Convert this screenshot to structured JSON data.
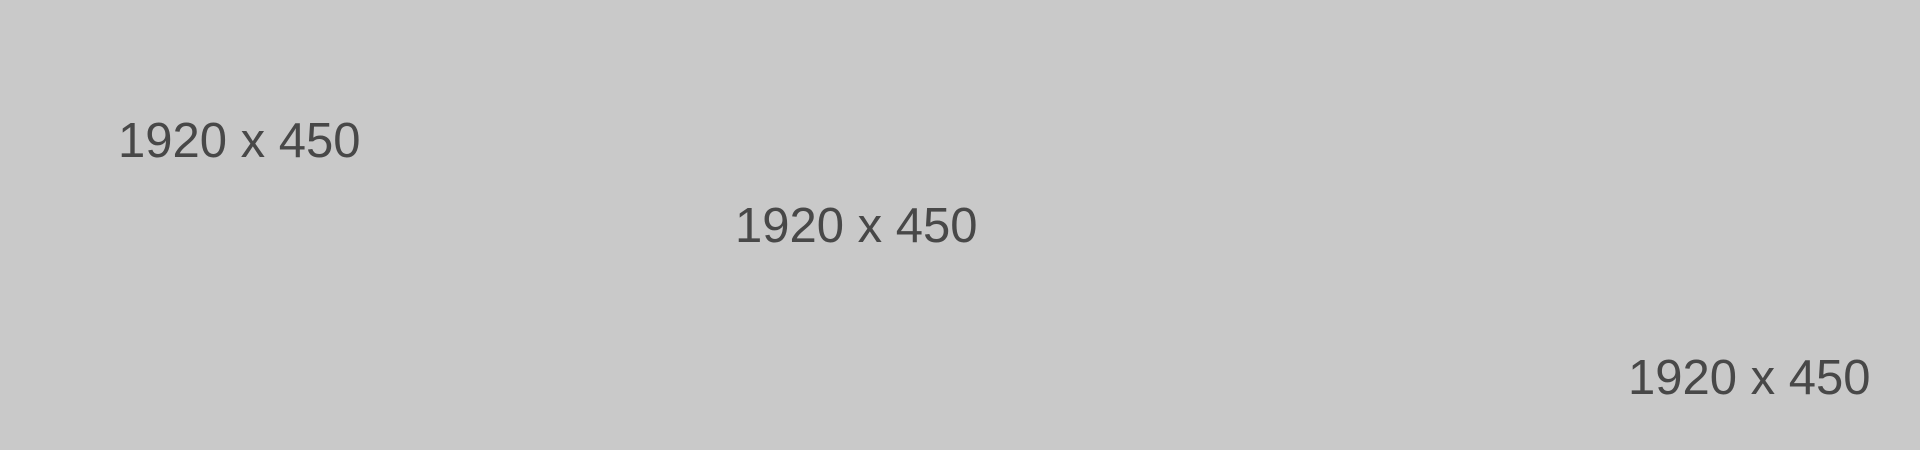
{
  "colors": {
    "background": "#c9c9c9",
    "text": "#484848"
  },
  "placeholder": {
    "labels": [
      "1920 x 450",
      "1920 x 450",
      "1920 x 450"
    ]
  }
}
